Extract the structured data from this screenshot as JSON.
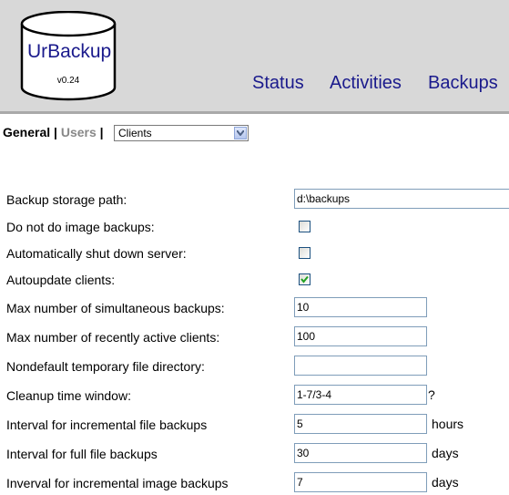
{
  "header": {
    "logo_title": "UrBackup",
    "logo_version": "v0.24",
    "nav": {
      "status": "Status",
      "activities": "Activities",
      "backups": "Backups"
    }
  },
  "tabs": {
    "general": "General",
    "users": "Users",
    "separator": "|"
  },
  "client_select": {
    "selected": "Clients"
  },
  "settings": {
    "backup_storage_path": {
      "label": "Backup storage path:",
      "value": "d:\\backups"
    },
    "no_image_backups": {
      "label": "Do not do image backups:",
      "checked": false
    },
    "auto_shutdown": {
      "label": "Automatically shut down server:",
      "checked": false
    },
    "autoupdate_clients": {
      "label": "Autoupdate clients:",
      "checked": true
    },
    "max_sim_backups": {
      "label": "Max number of simultaneous backups:",
      "value": "10"
    },
    "max_active_clients": {
      "label": "Max number of recently active clients:",
      "value": "100"
    },
    "tmp_dir": {
      "label": "Nondefault temporary file directory:",
      "value": ""
    },
    "cleanup_window": {
      "label": "Cleanup time window:",
      "value": "1-7/3-4",
      "help": "?"
    },
    "incr_file_interval": {
      "label": "Interval for incremental file backups",
      "value": "5",
      "unit": "hours"
    },
    "full_file_interval": {
      "label": "Interval for full file backups",
      "value": "30",
      "unit": "days"
    },
    "incr_image_interval": {
      "label": "Inverval for incremental image backups",
      "value": "7",
      "unit": "days"
    }
  }
}
